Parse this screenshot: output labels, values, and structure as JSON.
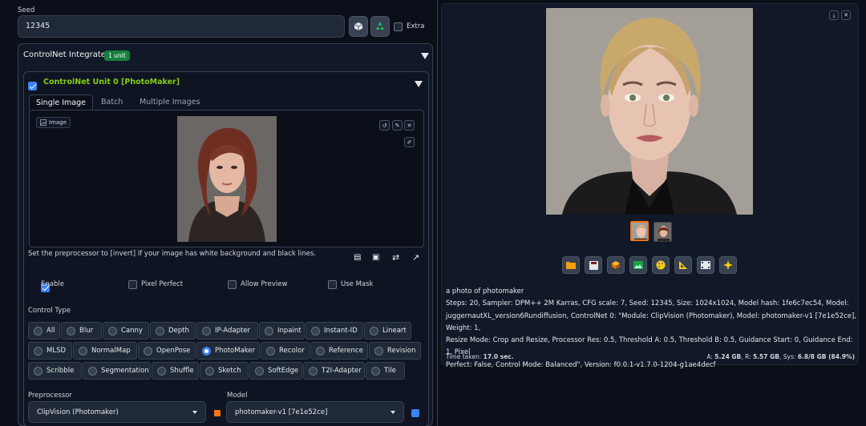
{
  "seed": {
    "label": "Seed",
    "value": "12345",
    "extra_label": "Extra"
  },
  "controlnet": {
    "title": "ControlNet Integrated",
    "badge": "1 unit",
    "unit": {
      "title": "ControlNet Unit 0 [PhotoMaker]",
      "tabs": [
        "Single Image",
        "Batch",
        "Multiple Images"
      ],
      "image_label": "Image",
      "hint": "Set the preprocessor to [invert] If your image has white background and black lines.",
      "checks": [
        {
          "label": "Enable",
          "checked": true
        },
        {
          "label": "Pixel Perfect",
          "checked": false
        },
        {
          "label": "Allow Preview",
          "checked": false
        },
        {
          "label": "Use Mask",
          "checked": false
        }
      ],
      "control_type_label": "Control Type",
      "control_types_row1": [
        "All",
        "Blur",
        "Canny",
        "Depth",
        "IP-Adapter",
        "Inpaint",
        "Instant-ID",
        "Lineart"
      ],
      "control_types_row2": [
        "MLSD",
        "NormalMap",
        "OpenPose",
        "PhotoMaker",
        "Recolor",
        "Reference",
        "Revision"
      ],
      "control_types_row3": [
        "Scribble",
        "Segmentation",
        "Shuffle",
        "Sketch",
        "SoftEdge",
        "T2I-Adapter",
        "Tile"
      ],
      "selected_type": "PhotoMaker",
      "preprocessor_label": "Preprocessor",
      "preprocessor_value": "ClipVision (Photomaker)",
      "model_label": "Model",
      "model_value": "photomaker-v1 [7e1e52ce]"
    }
  },
  "output": {
    "prompt": "a photo of photomaker",
    "params_lines": [
      "Steps: 20, Sampler: DPM++ 2M Karras, CFG scale: 7, Seed: 12345, Size: 1024x1024, Model hash: 1fe6c7ec54, Model:",
      "juggernautXL_version6Rundiffusion, ControlNet 0: \"Module: ClipVision (Photomaker), Model: photomaker-v1 [7e1e52ce], Weight: 1,",
      "Resize Mode: Crop and Resize, Processor Res: 0.5, Threshold A: 0.5, Threshold B: 0.5, Guidance Start: 0, Guidance End: 1, Pixel",
      "Perfect: False, Control Mode: Balanced\", Version: f0.0.1-v1.7.0-1204-g1ae4decf"
    ],
    "time_label": "Time taken:",
    "time_value": "17.0 sec.",
    "mem_a_label": "A:",
    "mem_a": "5.24 GB",
    "mem_r_label": "R:",
    "mem_r": "5.57 GB",
    "mem_sys_label": "Sys:",
    "mem_sys": "6.8/8 GB (84.9%)"
  },
  "colors": {
    "accent": "#3b82f6",
    "unit_title": "#84cc16",
    "badge": "#15803d",
    "recycle": "#22c55e",
    "thumb_selected": "#f97316"
  },
  "icons": {
    "seed_random": "dice-icon",
    "seed_reuse": "recycle-icon",
    "tools": [
      "folder-icon",
      "save-icon",
      "zip-icon",
      "image-icon",
      "palette-icon",
      "triangle-ruler-icon",
      "film-icon",
      "sparkle-icon"
    ]
  }
}
